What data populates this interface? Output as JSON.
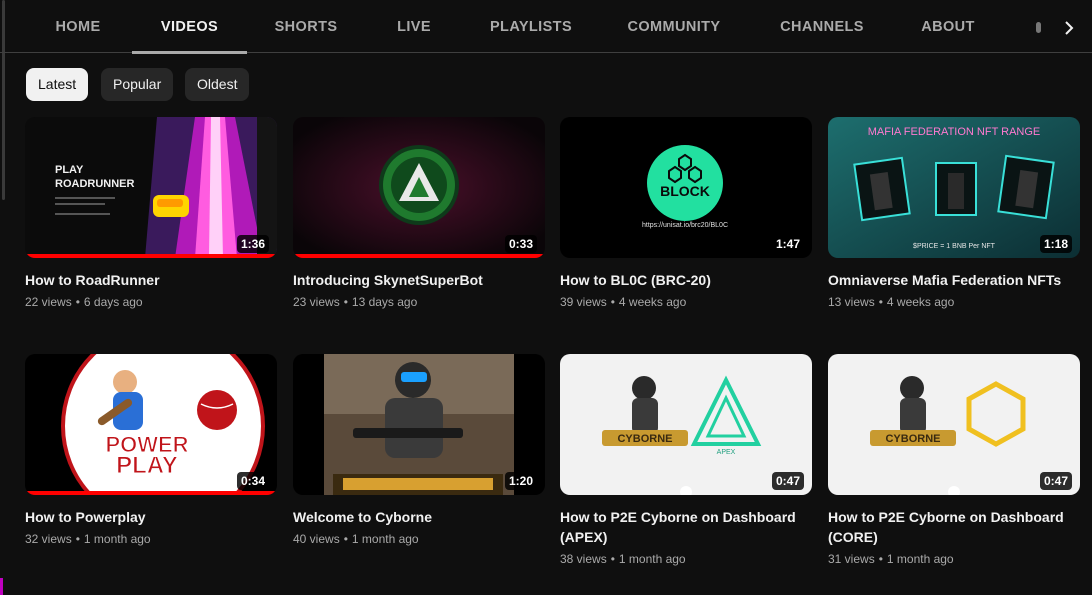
{
  "tabs": [
    {
      "label": "HOME"
    },
    {
      "label": "VIDEOS",
      "active": true
    },
    {
      "label": "SHORTS"
    },
    {
      "label": "LIVE"
    },
    {
      "label": "PLAYLISTS"
    },
    {
      "label": "COMMUNITY"
    },
    {
      "label": "CHANNELS"
    },
    {
      "label": "ABOUT"
    }
  ],
  "filters": [
    {
      "label": "Latest",
      "selected": true
    },
    {
      "label": "Popular"
    },
    {
      "label": "Oldest"
    }
  ],
  "videos": [
    {
      "title": "How to RoadRunner",
      "views": "22 views",
      "age": "6 days ago",
      "duration": "1:36",
      "watched": 1.0,
      "thumb_text": {
        "l1": "PLAY",
        "l2": "ROADRUNNER"
      }
    },
    {
      "title": "Introducing SkynetSuperBot",
      "views": "23 views",
      "age": "13 days ago",
      "duration": "0:33",
      "watched": 1.0
    },
    {
      "title": "How to BL0C (BRC-20)",
      "views": "39 views",
      "age": "4 weeks ago",
      "duration": "1:47",
      "thumb_text": {
        "badge": "BLOCK",
        "url": "https://unisat.io/brc20/BL0C"
      }
    },
    {
      "title": "Omniaverse Mafia Federation NFTs",
      "views": "13 views",
      "age": "4 weeks ago",
      "duration": "1:18",
      "thumb_text": {
        "heading": "MAFIA FEDERATION NFT RANGE",
        "price": "$PRICE = 1 BNB Per NFT"
      }
    },
    {
      "title": "How to Powerplay",
      "views": "32 views",
      "age": "1 month ago",
      "duration": "0:34",
      "watched": 1.0,
      "thumb_text": {
        "l1": "POWER",
        "l2": "PLAY"
      }
    },
    {
      "title": "Welcome to Cyborne",
      "views": "40 views",
      "age": "1 month ago",
      "duration": "1:20"
    },
    {
      "title": "How to P2E Cyborne on Dashboard (APEX)",
      "views": "38 views",
      "age": "1 month ago",
      "duration": "0:47",
      "thumb_text": {
        "logo": "CYBORNE",
        "mark": "APEX"
      }
    },
    {
      "title": "How to P2E Cyborne on Dashboard (CORE)",
      "views": "31 views",
      "age": "1 month ago",
      "duration": "0:47",
      "thumb_text": {
        "logo": "CYBORNE"
      }
    }
  ],
  "colors": {
    "background": "#0f0f0f",
    "chip": "#272727",
    "progress": "#ff0000",
    "muted": "#aaaaaa"
  },
  "icons": {
    "next": "chevron-right-icon"
  }
}
